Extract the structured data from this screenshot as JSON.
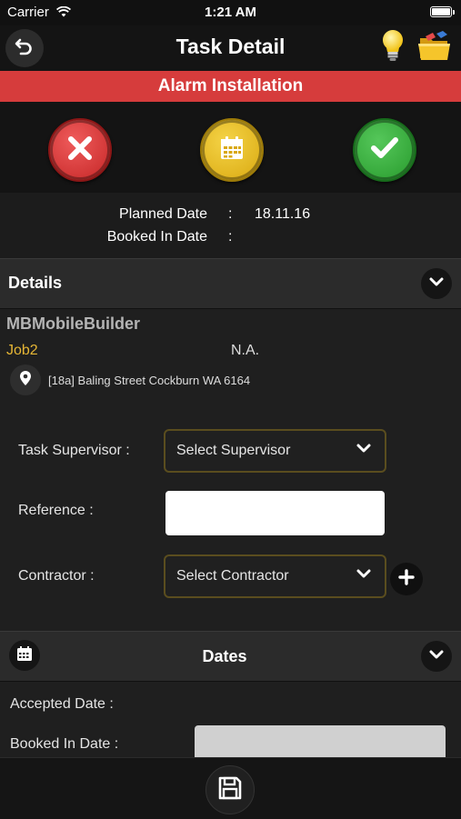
{
  "status_bar": {
    "carrier": "Carrier",
    "time": "1:21 AM",
    "battery_level": 1.0
  },
  "nav": {
    "title": "Task Detail",
    "back_icon": "back-arrow-icon",
    "hint_icon": "lightbulb-icon",
    "folder_icon": "folder-icon"
  },
  "banner": {
    "text": "Alarm Installation",
    "color": "#d63c3c"
  },
  "actions": [
    {
      "name": "reject",
      "icon": "x-icon",
      "color": "#d93232"
    },
    {
      "name": "schedule",
      "icon": "calendar-icon",
      "color": "#e8c11f"
    },
    {
      "name": "accept",
      "icon": "check-icon",
      "color": "#3aaa3f"
    }
  ],
  "task_info": {
    "planned_date_label": "Planned Date",
    "planned_date_value": "18.11.16",
    "booked_in_date_label": "Booked In Date",
    "booked_in_date_value": "",
    "separator": ":"
  },
  "details": {
    "header": "Details",
    "company": "MBMobileBuilder",
    "job": "Job2",
    "job_extra": "N.A.",
    "address": "[18a] Baling Street Cockburn WA 6164"
  },
  "form": {
    "supervisor_label": "Task Supervisor :",
    "supervisor_value": "Select Supervisor",
    "reference_label": "Reference :",
    "reference_value": "",
    "contractor_label": "Contractor :",
    "contractor_value": "Select Contractor"
  },
  "dates": {
    "header": "Dates",
    "accepted_date_label": "Accepted Date :",
    "booked_in_date_label": "Booked In Date :"
  },
  "colors": {
    "accent_yellow": "#e6b635",
    "banner_red": "#d63c3c"
  }
}
